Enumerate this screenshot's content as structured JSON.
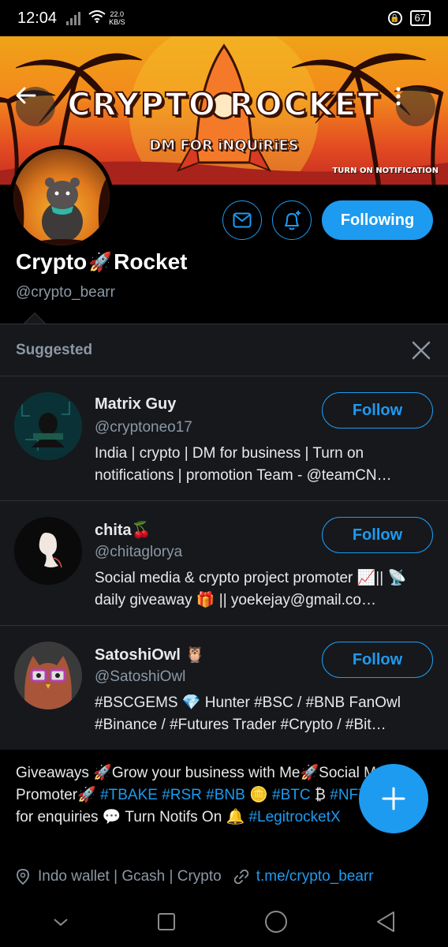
{
  "status_bar": {
    "time": "12:04",
    "speed_value": "22.0",
    "speed_unit": "KB/S",
    "battery": "67"
  },
  "banner": {
    "title": "CRYPTO ROCKET",
    "subtitle": "DM FOR iNQUiRiES",
    "notification_text": "TURN ON NOTIFICATION"
  },
  "profile": {
    "name_part1": "Crypto",
    "name_emoji": "🚀",
    "name_part2": "Rocket",
    "handle": "@crypto_bearr",
    "following_label": "Following"
  },
  "suggested": {
    "title": "Suggested",
    "items": [
      {
        "name": "Matrix Guy",
        "handle": "@cryptoneo17",
        "bio": "India | crypto | DM for business | Turn on notifications | promotion Team - @teamCN…",
        "button": "Follow"
      },
      {
        "name": "chita🍒",
        "handle": "@chitaglorya",
        "bio": "Social media & crypto project promoter 📈|| 📡daily giveaway 🎁 || yoekejay@gmail.co…",
        "button": "Follow"
      },
      {
        "name": "SatoshiOwl 🦉",
        "handle": "@SatoshiOwl",
        "bio": "#BSCGEMS 💎 Hunter #BSC / #BNB FanOwl #Binance / #Futures Trader  #Crypto / #Bit…",
        "button": "Follow"
      }
    ]
  },
  "bio": {
    "text1": "Giveaways 🚀Grow your business with Me🚀Social Media Promoter🚀 ",
    "tags1": "#TBAKE #RSR #BNB",
    "emoji1": "🪙 ",
    "tag_btc": "#BTC",
    "emoji2": " ₿ ",
    "tag_nft": "#NFT",
    "text2": "🚀 DM for enquiries 💬 Turn Notifs On 🔔 ",
    "tag_legit": "#LegitrocketX"
  },
  "meta": {
    "location": "Indo wallet | Gcash | Crypto",
    "link": "t.me/crypto_bearr"
  },
  "colors": {
    "accent": "#1d9bf0",
    "background": "#000000",
    "card": "#16181c",
    "muted": "#8b98a5"
  }
}
